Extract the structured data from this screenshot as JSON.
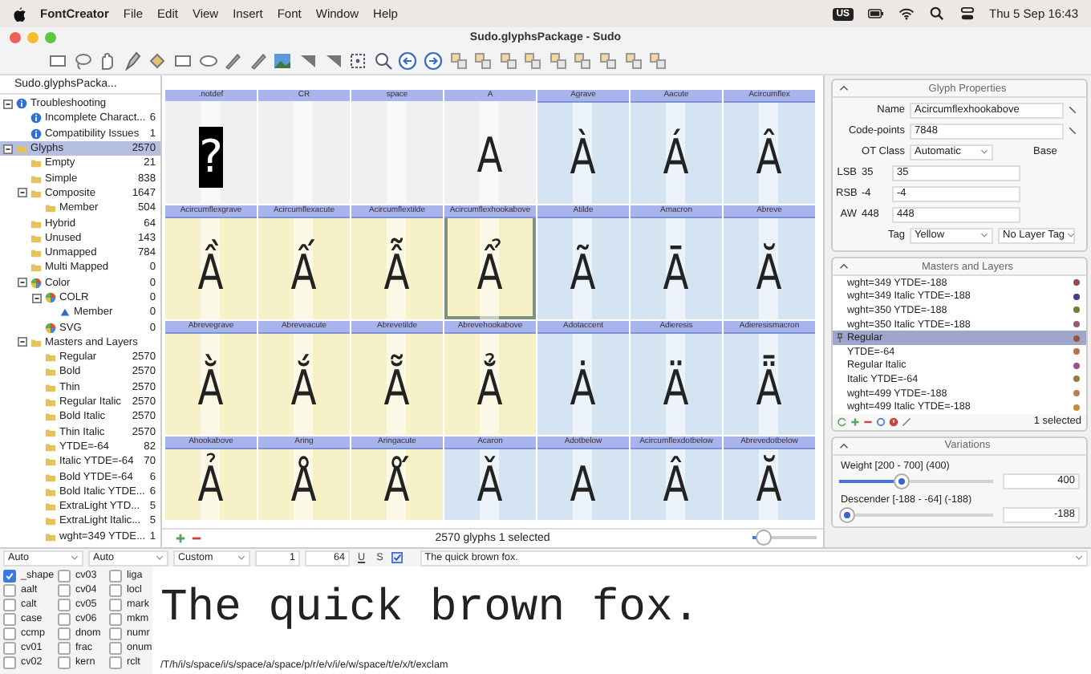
{
  "menubar": {
    "app": "FontCreator",
    "menus": [
      "File",
      "Edit",
      "View",
      "Insert",
      "Font",
      "Window",
      "Help"
    ],
    "input_source": "US",
    "clock": "Thu 5 Sep  16:43"
  },
  "window": {
    "title": "Sudo.glyphsPackage - Sudo"
  },
  "sidebar": {
    "tab": "Sudo.glyphsPacka...",
    "items": [
      {
        "label": "Troubleshooting",
        "kind": "info",
        "expanded": true,
        "selected": false,
        "children": [
          {
            "label": "Incomplete Charact...",
            "count": "6",
            "kind": "info",
            "selected": false
          },
          {
            "label": "Compatibility Issues",
            "count": "1",
            "kind": "info",
            "selected": false
          }
        ]
      },
      {
        "label": "Glyphs",
        "count": "2570",
        "kind": "folder",
        "expanded": true,
        "selected": true,
        "children": [
          {
            "label": "Empty",
            "count": "21",
            "kind": "folder",
            "selected": false
          },
          {
            "label": "Simple",
            "count": "838",
            "kind": "folder",
            "selected": false
          },
          {
            "label": "Composite",
            "count": "1647",
            "kind": "folder",
            "expanded": true,
            "selected": false,
            "children": [
              {
                "label": "Member",
                "count": "504",
                "kind": "folder",
                "selected": false
              }
            ]
          },
          {
            "label": "Hybrid",
            "count": "64",
            "kind": "folder",
            "selected": false
          },
          {
            "label": "Unused",
            "count": "143",
            "kind": "folder",
            "selected": false
          },
          {
            "label": "Unmapped",
            "count": "784",
            "kind": "folder",
            "selected": false
          },
          {
            "label": "Multi Mapped",
            "count": "0",
            "kind": "folder",
            "selected": false
          },
          {
            "label": "Color",
            "count": "0",
            "kind": "color",
            "expanded": true,
            "selected": false,
            "children": [
              {
                "label": "COLR",
                "count": "0",
                "kind": "color",
                "expanded": true,
                "selected": false,
                "children": [
                  {
                    "label": "Member",
                    "count": "0",
                    "kind": "member",
                    "selected": false
                  }
                ]
              },
              {
                "label": "SVG",
                "count": "0",
                "kind": "color",
                "selected": false
              }
            ]
          },
          {
            "label": "Masters and Layers",
            "kind": "folder",
            "expanded": true,
            "selected": false,
            "children": [
              {
                "label": "Regular",
                "count": "2570",
                "kind": "folder",
                "selected": false
              },
              {
                "label": "Bold",
                "count": "2570",
                "kind": "folder",
                "selected": false
              },
              {
                "label": "Thin",
                "count": "2570",
                "kind": "folder",
                "selected": false
              },
              {
                "label": "Regular Italic",
                "count": "2570",
                "kind": "folder",
                "selected": false
              },
              {
                "label": "Bold Italic",
                "count": "2570",
                "kind": "folder",
                "selected": false
              },
              {
                "label": "Thin Italic",
                "count": "2570",
                "kind": "folder",
                "selected": false
              },
              {
                "label": "YTDE=-64",
                "count": "82",
                "kind": "folder",
                "selected": false
              },
              {
                "label": "Italic YTDE=-64",
                "count": "70",
                "kind": "folder",
                "selected": false
              },
              {
                "label": "Bold YTDE=-64",
                "count": "6",
                "kind": "folder",
                "selected": false
              },
              {
                "label": "Bold Italic YTDE...",
                "count": "6",
                "kind": "folder",
                "selected": false
              },
              {
                "label": "ExtraLight YTD...",
                "count": "5",
                "kind": "folder",
                "selected": false
              },
              {
                "label": "ExtraLight Italic...",
                "count": "5",
                "kind": "folder",
                "selected": false
              },
              {
                "label": "wght=349 YTDE...",
                "count": "1",
                "kind": "folder",
                "selected": false
              }
            ]
          }
        ]
      }
    ]
  },
  "glyphs": [
    {
      "name": ".notdef",
      "char": "?",
      "kind": "notdef",
      "selected": false
    },
    {
      "name": "CR",
      "kind": "empty",
      "selected": false
    },
    {
      "name": "space",
      "kind": "empty",
      "selected": false
    },
    {
      "name": "A",
      "char": "A",
      "kind": "glyph",
      "selected": false
    },
    {
      "name": "Agrave",
      "char": "À",
      "kind": "glyph",
      "color": "#d4e4f2",
      "selected": false
    },
    {
      "name": "Aacute",
      "char": "Á",
      "kind": "glyph",
      "color": "#d4e4f2",
      "selected": false
    },
    {
      "name": "Acircumflex",
      "char": "Â",
      "kind": "glyph",
      "color": "#d4e4f2",
      "selected": false
    },
    {
      "name": "Acircumflexgrave",
      "char": "Ầ",
      "kind": "glyph",
      "color": "#f6f1c6",
      "selected": false
    },
    {
      "name": "Acircumflexacute",
      "char": "Ấ",
      "kind": "glyph",
      "color": "#f6f1c6",
      "selected": false
    },
    {
      "name": "Acircumflextilde",
      "char": "Ẫ",
      "kind": "glyph",
      "color": "#f6f1c6",
      "selected": false
    },
    {
      "name": "Acircumflexhookabove",
      "char": "Ẩ",
      "kind": "glyph",
      "color": "#f6f1c6",
      "selected": true
    },
    {
      "name": "Atilde",
      "char": "Ã",
      "kind": "glyph",
      "color": "#d4e4f2",
      "selected": false
    },
    {
      "name": "Amacron",
      "char": "Ā",
      "kind": "glyph",
      "color": "#d4e4f2",
      "selected": false
    },
    {
      "name": "Abreve",
      "char": "Ă",
      "kind": "glyph",
      "color": "#d4e4f2",
      "selected": false
    },
    {
      "name": "Abrevegrave",
      "char": "Ằ",
      "kind": "glyph",
      "color": "#f6f1c6",
      "selected": false
    },
    {
      "name": "Abreveacute",
      "char": "Ắ",
      "kind": "glyph",
      "color": "#f6f1c6",
      "selected": false
    },
    {
      "name": "Abrevetilde",
      "char": "Ẵ",
      "kind": "glyph",
      "color": "#f6f1c6",
      "selected": false
    },
    {
      "name": "Abrevehookabove",
      "char": "Ẳ",
      "kind": "glyph",
      "color": "#f6f1c6",
      "selected": false
    },
    {
      "name": "Adotaccent",
      "char": "Ȧ",
      "kind": "glyph",
      "color": "#d4e4f2",
      "selected": false
    },
    {
      "name": "Adieresis",
      "char": "Ä",
      "kind": "glyph",
      "color": "#d4e4f2",
      "selected": false
    },
    {
      "name": "Adieresismacron",
      "char": "Ǟ",
      "kind": "glyph",
      "color": "#d4e4f2",
      "selected": false
    },
    {
      "name": "Ahookabove",
      "char": "Ả",
      "kind": "glyph",
      "color": "#f6f1c6",
      "selected": false
    },
    {
      "name": "Aring",
      "char": "Å",
      "kind": "glyph",
      "color": "#f6f1c6",
      "selected": false
    },
    {
      "name": "Aringacute",
      "char": "Ǻ",
      "kind": "glyph",
      "color": "#f6f1c6",
      "selected": false
    },
    {
      "name": "Acaron",
      "char": "Ǎ",
      "kind": "glyph",
      "color": "#d4e4f2",
      "selected": false
    },
    {
      "name": "Adotbelow",
      "char": "A",
      "kind": "glyph",
      "color": "#d4e4f2",
      "selected": false
    },
    {
      "name": "Acircumflexdotbelow",
      "char": "Â",
      "kind": "glyph",
      "color": "#d4e4f2",
      "selected": false
    },
    {
      "name": "Abrevedotbelow",
      "char": "Ă",
      "kind": "glyph",
      "color": "#d4e4f2",
      "selected": false
    }
  ],
  "status": "2570 glyphs 1 selected",
  "zoom": {
    "level": 0.1
  },
  "glyph_properties": {
    "title": "Glyph Properties",
    "name_label": "Name",
    "name": "Acircumflexhookabove",
    "codepoints_label": "Code-points",
    "codepoints": "7848",
    "otclass_label": "OT Class",
    "otclass": "Automatic",
    "base": "Base",
    "metrics": [
      {
        "label": "LSB",
        "value": "35",
        "input": "35"
      },
      {
        "label": "RSB",
        "value": "-4",
        "input": "-4"
      },
      {
        "label": "AW",
        "value": "448",
        "input": "448"
      }
    ],
    "tag_label": "Tag",
    "tag": "Yellow",
    "layer_tag": "No Layer Tag"
  },
  "masters": {
    "title": "Masters and Layers",
    "items": [
      {
        "name": "wght=349 YTDE=-188",
        "color": "#9b4a55",
        "selected": false
      },
      {
        "name": "wght=349 Italic YTDE=-188",
        "color": "#3a3f8f",
        "selected": false
      },
      {
        "name": "wght=350 YTDE=-188",
        "color": "#6a7f3a",
        "selected": false
      },
      {
        "name": "wght=350 Italic YTDE=-188",
        "color": "#9a5a7a",
        "selected": false
      },
      {
        "name": "Regular",
        "color": "#a0503a",
        "selected": true
      },
      {
        "name": "YTDE=-64",
        "color": "#c0704a",
        "selected": false
      },
      {
        "name": "Regular Italic",
        "color": "#a0508a",
        "selected": false
      },
      {
        "name": "Italic YTDE=-64",
        "color": "#9a7a3a",
        "selected": false
      },
      {
        "name": "wght=499 YTDE=-188",
        "color": "#c07a5a",
        "selected": false
      },
      {
        "name": "wght=499 Italic YTDE=-188",
        "color": "#c0903a",
        "selected": false
      }
    ],
    "selected_count": "1 selected"
  },
  "variations": {
    "title": "Variations",
    "axes": [
      {
        "label": "Weight [200 - 700] (400)",
        "level": 0.4,
        "value": "400"
      },
      {
        "label": "Descender [-188 - -64] (-188)",
        "level": 0,
        "value": "-188"
      }
    ]
  },
  "preview_bar": {
    "script": "Auto",
    "language": "Auto",
    "size_mode": "Custom",
    "start": "1",
    "size": "64",
    "underline": "U",
    "strike": "S",
    "wrap_on": true,
    "text": "The quick brown fox."
  },
  "features": [
    {
      "tag": "_shape",
      "checked": true
    },
    {
      "tag": "aalt",
      "checked": false
    },
    {
      "tag": "calt",
      "checked": false
    },
    {
      "tag": "case",
      "checked": false
    },
    {
      "tag": "ccmp",
      "checked": false
    },
    {
      "tag": "cv01",
      "checked": false
    },
    {
      "tag": "cv02",
      "checked": false
    },
    {
      "tag": "cv03",
      "checked": false
    },
    {
      "tag": "cv04",
      "checked": false
    },
    {
      "tag": "cv05",
      "checked": false
    },
    {
      "tag": "cv06",
      "checked": false
    },
    {
      "tag": "dnom",
      "checked": false
    },
    {
      "tag": "frac",
      "checked": false
    },
    {
      "tag": "kern",
      "checked": false
    },
    {
      "tag": "liga",
      "checked": false
    },
    {
      "tag": "locl",
      "checked": false
    },
    {
      "tag": "mark",
      "checked": false
    },
    {
      "tag": "mkm",
      "checked": false
    },
    {
      "tag": "numr",
      "checked": false
    },
    {
      "tag": "onum",
      "checked": false
    },
    {
      "tag": "rclt",
      "checked": false
    }
  ],
  "preview_text": "The quick brown fox.",
  "glyph_string": "/T/h/i/s/space/i/s/space/a/space/p/r/e/v/i/e/w/space/t/e/x/t/exclam"
}
